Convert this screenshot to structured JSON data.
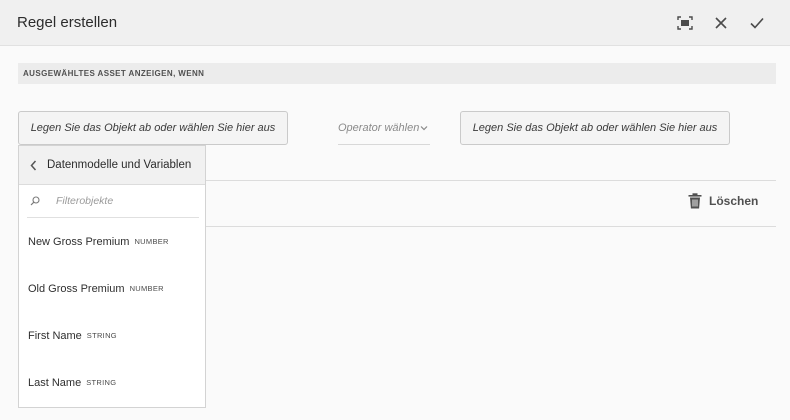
{
  "dialog": {
    "title": "Regel erstellen",
    "icons": {
      "fullscreen": "fullscreen-icon",
      "close": "close-icon",
      "confirm": "checkmark-icon"
    }
  },
  "section": {
    "label": "AUSGEWÄHLTES ASSET ANZEIGEN, WENN"
  },
  "condition": {
    "left_object": "Legen Sie das Objekt ab oder wählen Sie hier aus",
    "operator_placeholder": "Operator wählen",
    "right_object": "Legen Sie das Objekt ab oder wählen Sie hier aus"
  },
  "delete": {
    "label": "Löschen",
    "icon": "trash-icon"
  },
  "dropdown": {
    "header": "Datenmodelle und Variablen",
    "filter_placeholder": "Filterobjekte",
    "items": [
      {
        "name": "New Gross Premium",
        "type": "NUMBER"
      },
      {
        "name": "Old Gross Premium",
        "type": "NUMBER"
      },
      {
        "name": "First Name",
        "type": "STRING"
      },
      {
        "name": "Last Name",
        "type": "STRING"
      }
    ]
  },
  "colors": {
    "header_bg": "#f0f0f0",
    "page_bg": "#fafafa",
    "button_bg": "#f4f4f4",
    "text": "#323232"
  }
}
